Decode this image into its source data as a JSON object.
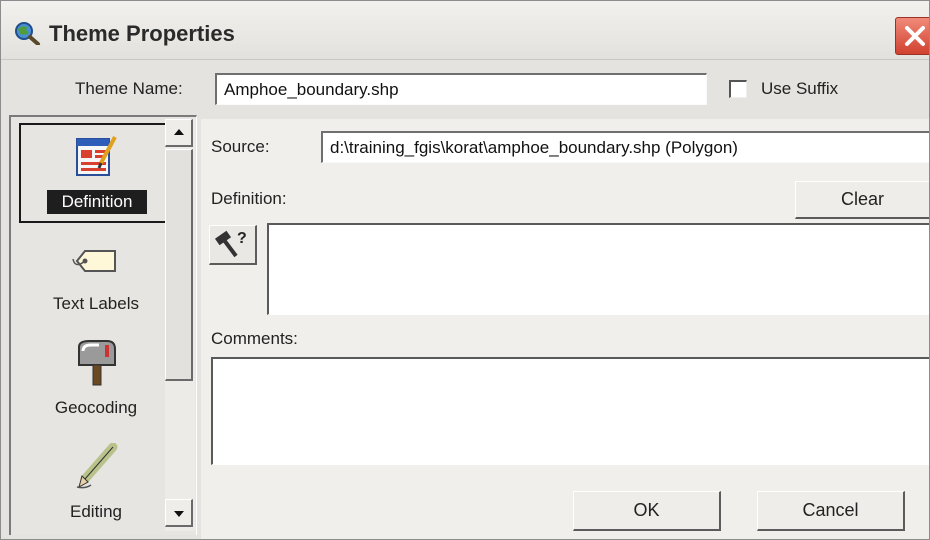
{
  "window": {
    "title": "Theme Properties",
    "app_icon": "magnifier-globe-icon",
    "close_icon": "close-icon"
  },
  "theme_name": {
    "label": "Theme Name:",
    "value": "Amphoe_boundary.shp",
    "use_suffix_label": "Use Suffix",
    "use_suffix_checked": false
  },
  "categories": {
    "items": [
      {
        "label": "Definition",
        "icon": "definition-form-icon",
        "selected": true
      },
      {
        "label": "Text Labels",
        "icon": "tag-label-icon",
        "selected": false
      },
      {
        "label": "Geocoding",
        "icon": "mailbox-icon",
        "selected": false
      },
      {
        "label": "Editing",
        "icon": "pencil-icon",
        "selected": false
      }
    ]
  },
  "definition_pane": {
    "source_label": "Source:",
    "source_value": "d:\\training_fgis\\korat\\amphoe_boundary.shp (Polygon)",
    "definition_label": "Definition:",
    "clear_label": "Clear",
    "definition_value": "",
    "query_builder_icon": "hammer-question-icon",
    "comments_label": "Comments:",
    "comments_value": ""
  },
  "footer": {
    "ok_label": "OK",
    "cancel_label": "Cancel"
  },
  "colors": {
    "selected_label_bg": "#1e1e1e",
    "close_red": "#d1412e",
    "dialog_bg": "#e4e3df"
  }
}
